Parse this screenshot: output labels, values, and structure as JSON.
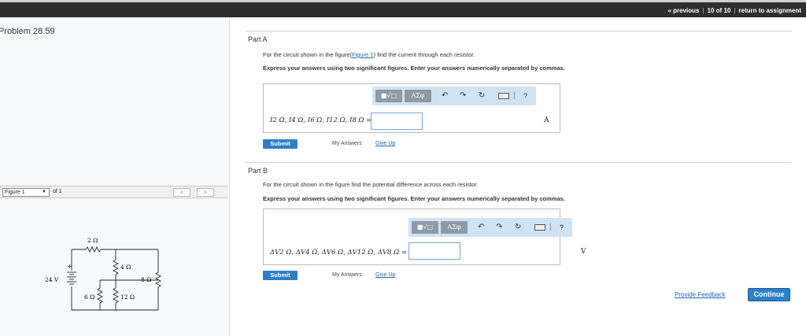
{
  "topnav": {
    "previous": "« previous",
    "position": "10 of 10",
    "return": "return to assignment"
  },
  "problem": {
    "title": "Problem 28.59"
  },
  "figure_bar": {
    "selected": "Figure 1",
    "of_label": "of 1",
    "prev_glyph": "<",
    "next_glyph": ">"
  },
  "circuit": {
    "source": "24 V",
    "plus": "+",
    "r2": "2 Ω",
    "r4": "4 Ω",
    "r8": "8 Ω",
    "r6": "6 Ω",
    "r12": "12 Ω"
  },
  "partA": {
    "title": "Part A",
    "question_pre": "For the circuit shown in the figure(",
    "question_link": "Figure 1",
    "question_post": ") find the current through each resistor.",
    "instruction": "Express your answers using two significant figures. Enter your answers numerically separated by commas.",
    "label": "I2 Ω, I4 Ω, I6 Ω, I12 Ω, I8 Ω =",
    "value": "",
    "unit": "A",
    "submit": "Submit",
    "my_answers": "My Answers",
    "give_up": "Give Up"
  },
  "partB": {
    "title": "Part B",
    "question": "For the circuit shown in the figure find the potential difference across each resistor.",
    "instruction": "Express your answers using two significant figures. Enter your answers numerically separated by commas.",
    "label": "ΔV2 Ω, ΔV4 Ω, ΔV6 Ω, ΔV12 Ω, ΔV8 Ω =",
    "value": "",
    "unit": "V",
    "submit": "Submit",
    "my_answers": "My Answers",
    "give_up": "Give Up"
  },
  "toolbar": {
    "template_btn": "■√□",
    "symbol_btn": "ΑΣφ",
    "help": "?"
  },
  "footer": {
    "feedback": "Provide Feedback",
    "continue": "Continue"
  }
}
